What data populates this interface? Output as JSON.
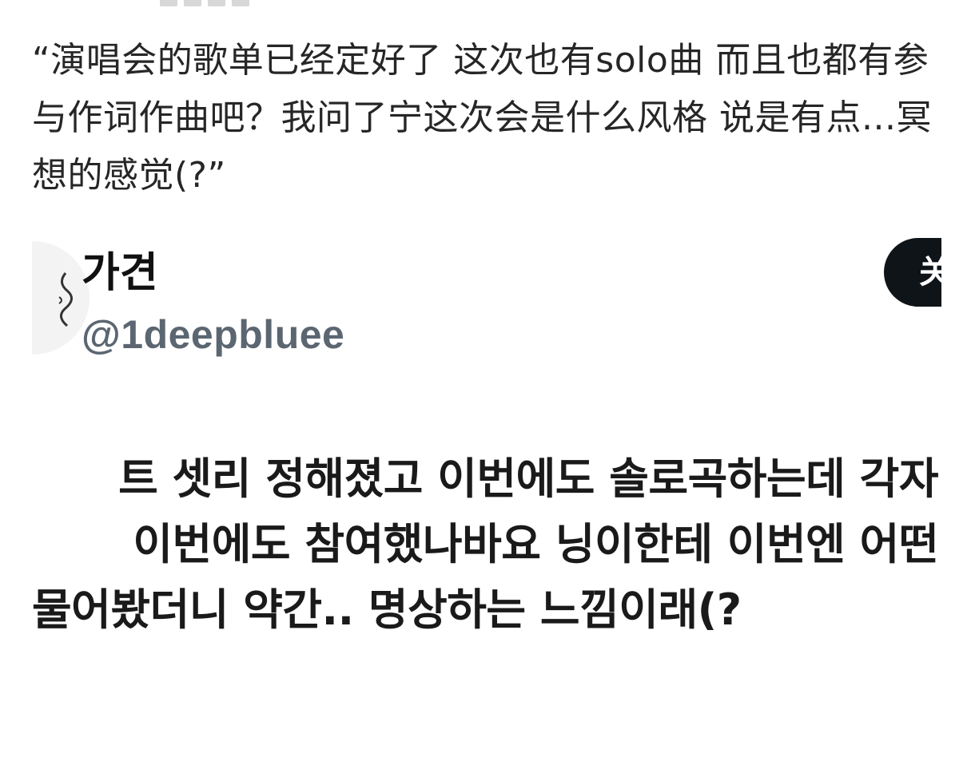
{
  "caption": {
    "text": "“演唱会的歌单已经定好了 这次也有solo曲 而且也都有参与作词作曲吧？我问了宁这次会是什么风格 说是有点...冥想的感觉(?”"
  },
  "tweet": {
    "display_name": "가견",
    "handle": "@1deepbluee",
    "follow_button_label": "关",
    "lines": [
      "트 셋리 정해졌고 이번에도 솔로곡하는데 각자",
      "이번에도 참여했나바요 닝이한테 이번엔 어떤",
      "물어봤더니 약간.. 명상하는 느낌이래(?"
    ]
  },
  "colors": {
    "caption_text": "#262626",
    "name_text": "#111111",
    "handle_text": "#5b6671",
    "follow_button_bg": "#0f1419",
    "follow_button_text": "#ffffff",
    "background": "#ffffff"
  }
}
